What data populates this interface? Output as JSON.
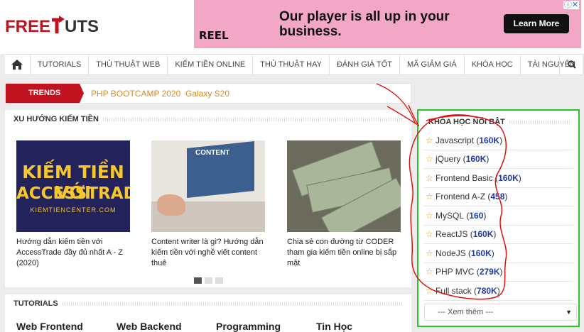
{
  "header": {
    "logo_free": "FREE",
    "logo_tuts": "UTS",
    "ad": {
      "headline": "Our player is all up in your business.",
      "cta": "Learn More",
      "brand": "REEL"
    }
  },
  "nav": {
    "items": [
      "TUTORIALS",
      "THỦ THUẬT WEB",
      "KIẾM TIỀN ONLINE",
      "THỦ THUẬT HAY",
      "ĐÁNH GIÁ TỐT",
      "MÃ GIẢM GIÁ",
      "KHÓA HỌC",
      "TÀI NGUYÊN"
    ]
  },
  "trends": {
    "label": "TRENDS",
    "links": [
      "PHP BOOTCAMP 2020",
      "Galaxy S20"
    ]
  },
  "earn": {
    "title": "XU HƯỚNG KIẾM TIỀN",
    "cards": [
      {
        "title": "Hướng dẫn kiếm tiền với AccessTrade đầy đủ nhất A - Z (2020)",
        "thumb_line1": "KIẾM TIỀN VỚI",
        "thumb_line2": "ACCESSTRADE",
        "thumb_line3": "KIEMTIENCENTER.COM"
      },
      {
        "title": "Content writer là gì? Hướng dẫn kiếm tiền với nghề viết content thuê",
        "thumb_label": "CONTENT"
      },
      {
        "title": "Chia sẻ con đường từ CODER tham gia kiếm tiền online bị sắp mặt"
      }
    ]
  },
  "tutorials": {
    "title": "TUTORIALS",
    "columns": [
      "Web Frontend",
      "Web Backend",
      "Programming",
      "Tin Học"
    ]
  },
  "sidebar": {
    "title": "KHÓA HỌC NỔI BẬT",
    "items": [
      {
        "name": "Javascript",
        "count": "160K"
      },
      {
        "name": "jQuery",
        "count": "160K"
      },
      {
        "name": "Frontend Basic",
        "count": "160K"
      },
      {
        "name": "Frontend A-Z",
        "count": "458"
      },
      {
        "name": "MySQL",
        "count": "160"
      },
      {
        "name": "ReactJS",
        "count": "160K"
      },
      {
        "name": "NodeJS",
        "count": "160K"
      },
      {
        "name": "PHP MVC",
        "count": "279K"
      },
      {
        "name": "Full stack",
        "count": "780K"
      }
    ],
    "select_label": "--- Xem thêm ---"
  },
  "colors": {
    "brand_red": "#c1121f",
    "trend_link": "#e0891d",
    "count_blue": "#1f3aa5",
    "highlight_green": "#2bc62b",
    "annotation_red": "#e01010"
  }
}
